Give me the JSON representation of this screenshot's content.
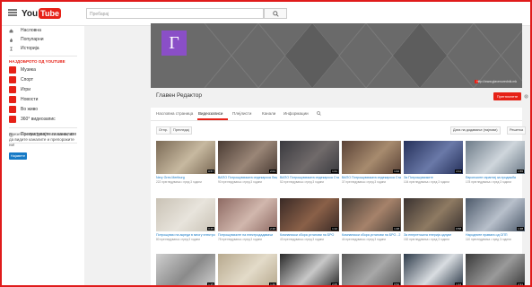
{
  "masthead": {
    "logo_you": "You",
    "logo_tube": "Tube",
    "search_placeholder": "Пребарај"
  },
  "sidebar": {
    "nav": [
      "Насловна",
      "Популарни",
      "Историја"
    ],
    "section_title": "НАЈДОБРОТО ОД YOUTUBE",
    "subs": [
      {
        "label": "Музика",
        "color": "#e62117"
      },
      {
        "label": "Спорт",
        "color": "#e62117"
      },
      {
        "label": "Игри",
        "color": "#e62117"
      },
      {
        "label": "Новости",
        "color": "#e62117"
      },
      {
        "label": "Во живо",
        "color": "#e62117"
      },
      {
        "label": "360° видеозапис",
        "color": "#e62117"
      }
    ],
    "browse_channels": "Прелистувајте ги каналите",
    "signin_text": "Влезете и прифатете ги своите, за да видите каналите и препораките ни!",
    "signin_button": "Најавете"
  },
  "channel": {
    "avatar_letter": "Г",
    "banner_link": "http://www.glavenurednik.mk",
    "title": "Главен Редактор",
    "subscribe_label": "Претплатете",
    "tabs": [
      "Насловна страница",
      "Видеозаписи",
      "Плејлисти",
      "Канали",
      "Информации"
    ],
    "active_tab": 1,
    "upload_label": "Отпр.",
    "browse_label": "Прегледај",
    "sort_label": "Дата на додавање (најнови)",
    "grid_label": "Решетка"
  },
  "videos": [
    {
      "title": "Nery Gres Mertburg",
      "meta": "222 прегледувања • пред 3 години",
      "thumb": "#7b6a55",
      "thumb2": "#c7b9a0",
      "dur": "0:57"
    },
    {
      "title": "ВАПО Потрошувачката индекарска Лицата",
      "meta": "90 прегледувања • пред 3 години",
      "thumb": "#4a3b33",
      "thumb2": "#9a8677",
      "dur": "2:01"
    },
    {
      "title": "ВАПО Потрошувачката индекарска Стална на ...",
      "meta": "52 прегледувања • пред 3 години",
      "thumb": "#3a3a3f",
      "thumb2": "#706a6a",
      "dur": "1:41"
    },
    {
      "title": "ВАПО Потрошувачката индекарска Стана",
      "meta": "37 прегледувања • пред 3 години",
      "thumb": "#5a4236",
      "thumb2": "#a78b6e",
      "dur": "1:02"
    },
    {
      "title": "За Потрошувачките",
      "meta": "104 прегледувања • пред 3 години",
      "thumb": "#25305a",
      "thumb2": "#6a79a8",
      "dur": "2:11"
    },
    {
      "title": "Европските гарантиј за продажба",
      "meta": "178 прегледувања • пред 3 години",
      "thumb": "#6d7b88",
      "thumb2": "#cfd6dc",
      "dur": "1:55"
    },
    {
      "title": "Потрошувач на акреди в многу електронски интернет",
      "meta": "80 прегледувања • пред 3 години",
      "thumb": "#c9c2b5",
      "thumb2": "#e8e4dc",
      "dur": "0:45"
    },
    {
      "title": "Потрошувачите на електродадавачи",
      "meta": "78 прегледувања • пред 3 години",
      "thumb": "#8e6a63",
      "thumb2": "#d1b7ad",
      "dur": "2:20"
    },
    {
      "title": "Компаниски сбора установи на БРО",
      "meta": "43 прегледувања • пред 3 години",
      "thumb": "#3a2a26",
      "thumb2": "#8a6048",
      "dur": "1:12"
    },
    {
      "title": "Компаниски сбора установи на БРО - 2",
      "meta": "44 прегледувања • пред 3 години",
      "thumb": "#4a4038",
      "thumb2": "#a6826a",
      "dur": "1:48"
    },
    {
      "title": "За енергетската енерија одлуке",
      "meta": "152 прегледувања • пред 3 години",
      "thumb": "#3a3230",
      "thumb2": "#8e7a62",
      "dur": "0:58"
    },
    {
      "title": "Народните правата од ОПП",
      "meta": "110 прегледувања • пред 3 години",
      "thumb": "#4d5a6b",
      "thumb2": "#b8c0cb",
      "dur": "1:38"
    },
    {
      "title": "",
      "meta": "",
      "thumb": "#cfcfcf",
      "thumb2": "#8a8a8a",
      "dur": "1:25"
    },
    {
      "title": "",
      "meta": "",
      "thumb": "#b7a98e",
      "thumb2": "#e3dbc9",
      "dur": "1:40"
    },
    {
      "title": "",
      "meta": "",
      "thumb": "#2a2a2a",
      "thumb2": "#c8c8c8",
      "dur": "2:05"
    },
    {
      "title": "",
      "meta": "",
      "thumb": "#585858",
      "thumb2": "#a8a8a8",
      "dur": "0:52"
    },
    {
      "title": "",
      "meta": "",
      "thumb": "#2e3b4a",
      "thumb2": "#d9dde1",
      "dur": "1:14"
    },
    {
      "title": "",
      "meta": "",
      "thumb": "#3a3a3a",
      "thumb2": "#9a9a9a",
      "dur": "2:31"
    }
  ]
}
